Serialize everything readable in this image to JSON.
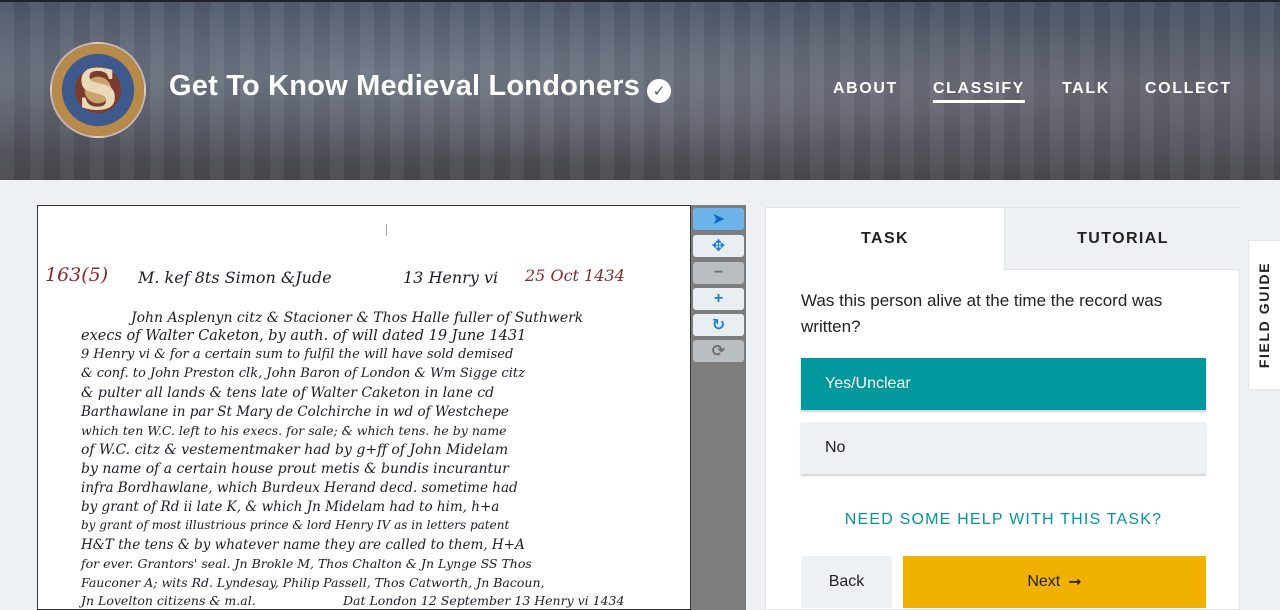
{
  "header": {
    "project_title": "Get To Know Medieval Londoners",
    "avatar_letter": "S",
    "nav": [
      {
        "label": "ABOUT",
        "active": false
      },
      {
        "label": "CLASSIFY",
        "active": true
      },
      {
        "label": "TALK",
        "active": false
      },
      {
        "label": "COLLECT",
        "active": false
      }
    ]
  },
  "document": {
    "lines": [
      "163(5)",
      "M. kef 8ts Simon &Jude",
      "13 Henry vi",
      "25 Oct 1434",
      "John Asplenyn citz & Stacioner & Thos Halle fuller of Suthwerk",
      "execs of Walter Caketon, by auth. of will dated 19 June 1431",
      "9 Henry vi & for a certain sum to fulfil the will have sold demised",
      "& conf. to John Preston clk, John Baron of London & Wm Sigge citz",
      "& pulter all lands & tens late of Walter Caketon in lane cd",
      "Barthawlane in par St Mary de Colchirche in wd of Westchepe",
      "which ten W.C. left to his execs. for sale; & which tens. he by name",
      "of W.C. citz & vestementmaker had by g+ff of John Midelam",
      "by name of a certain house prout metis & bundis incurantur",
      "infra Bordhawlane, which Burdeux Herand decd. sometime had",
      "by grant of Rd ii late K, & which Jn Midelam had to him, h+a",
      "by grant of most illustrious prince & lord Henry IV as in letters patent",
      "H&T the tens & by whatever name they are called to them, H+A",
      "for ever. Grantors' seal. Jn Brokle M, Thos Chalton & Jn Lynge SS Thos",
      "Fauconer A; wits Rd. Lyndesay, Philip Passell, Thos Catworth, Jn Bacoun,",
      "Jn Lovelton citizens & m.al.",
      "Dat London 12 September 13 Henry vi 1434"
    ]
  },
  "tools": [
    {
      "name": "pointer-tool-icon",
      "glyph": "➤"
    },
    {
      "name": "move-tool-icon",
      "glyph": "✥"
    },
    {
      "name": "zoom-out-tool-icon",
      "glyph": "−"
    },
    {
      "name": "zoom-in-tool-icon",
      "glyph": "+"
    },
    {
      "name": "rotate-tool-icon",
      "glyph": "↻"
    },
    {
      "name": "reset-tool-icon",
      "glyph": "⟳"
    }
  ],
  "panel": {
    "tabs": {
      "task": "TASK",
      "tutorial": "TUTORIAL"
    },
    "question": "Was this person alive at the time the record was written?",
    "answers": [
      {
        "label": "Yes/Unclear",
        "selected": true
      },
      {
        "label": "No",
        "selected": false
      }
    ],
    "help_link": "NEED SOME HELP WITH THIS TASK?",
    "back_label": "Back",
    "next_label": "Next",
    "next_arrow": "➞"
  },
  "field_guide_label": "FIELD GUIDE",
  "colors": {
    "accent_teal": "#00979d",
    "next_yellow": "#f0b100",
    "tool_blue": "#6cb4ea"
  }
}
